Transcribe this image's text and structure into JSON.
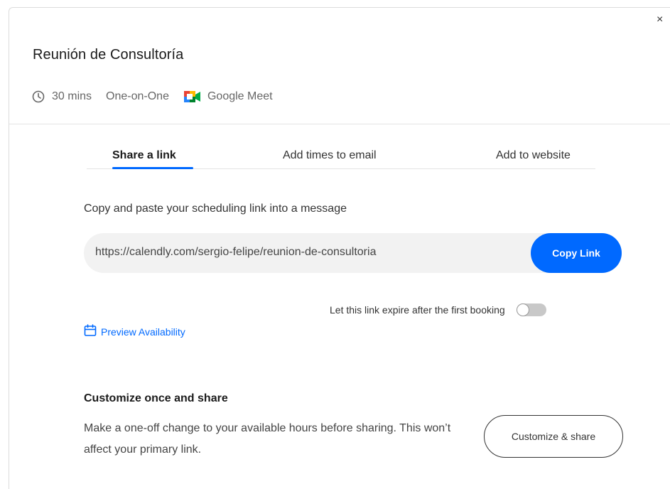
{
  "close_glyph": "×",
  "event": {
    "title": "Reunión de Consultoría",
    "duration": "30 mins",
    "type": "One-on-One",
    "location": "Google Meet",
    "icons": {
      "duration": "clock-icon",
      "location": "google-meet-icon"
    }
  },
  "tabs": [
    {
      "label": "Share a link",
      "active": true
    },
    {
      "label": "Add times to email",
      "active": false
    },
    {
      "label": "Add to website",
      "active": false
    }
  ],
  "share": {
    "instruction": "Copy and paste your scheduling link into a message",
    "link": "https://calendly.com/sergio-felipe/reunion-de-consultoria",
    "copy_label": "Copy Link",
    "expire_label": "Let this link expire after the first booking",
    "expire_enabled": false,
    "preview_label": "Preview Availability",
    "preview_icon": "calendar-icon"
  },
  "customize": {
    "title": "Customize once and share",
    "description": "Make a one-off change to your available hours before sharing. This won’t affect your primary link.",
    "button_label": "Customize & share"
  },
  "colors": {
    "accent": "#0069ff",
    "link_box": "#f2f2f2",
    "toggle_off": "#c8c8c8"
  }
}
